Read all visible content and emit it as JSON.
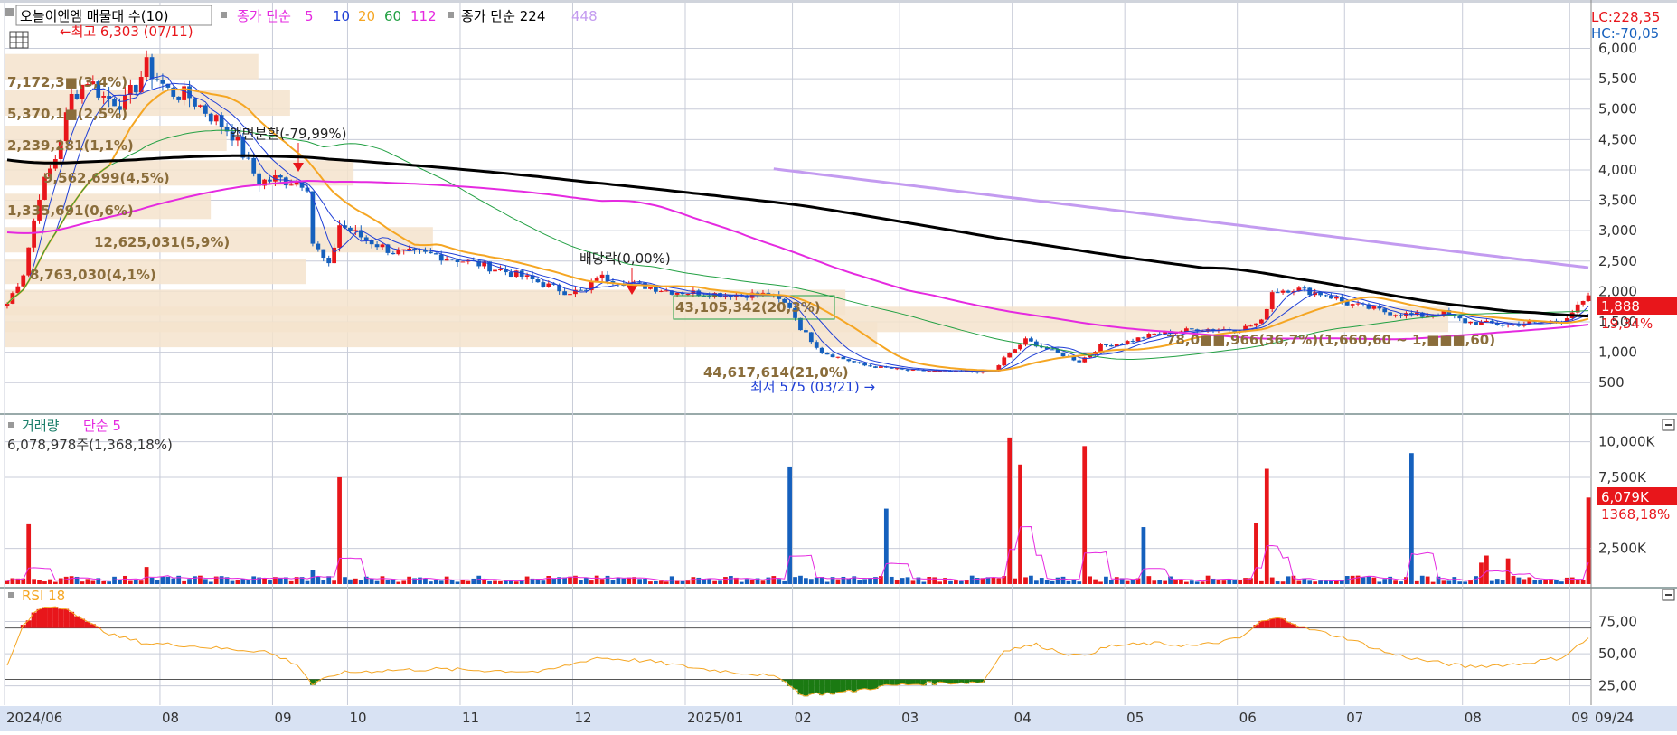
{
  "colors": {
    "up": "#e8161b",
    "down": "#1560bd",
    "ma5": "#1f3fd6",
    "ma10": "#1f3fd6",
    "ma20": "#f5a623",
    "ma60": "#22a043",
    "ma112": "#e52ae0",
    "ma224": "#000000",
    "ma448": "#c39bf0",
    "profile": "#f5e3cc",
    "rsi_line": "#f5a623",
    "rsi_hot": "#e8161b",
    "rsi_cold": "#1b7a12",
    "grid": "#c8ccd8",
    "axis_bg": "#d8e2f3"
  },
  "header": {
    "title": "오늘이엔엠 매물대 수(10)",
    "ma_label": "종가 단순",
    "ma_periods": [
      "5",
      "10",
      "20",
      "60",
      "112"
    ],
    "ma2_label": "종가 단순 224",
    "ma2_extra": "448",
    "lc_label": "LC:228,35",
    "hc_label": "HC:-70,05",
    "grid_icon": "grid-icon"
  },
  "annotations": {
    "high_label": "←최고 6,303 (07/11)",
    "low_label": "최저 575 (03/21) →",
    "split_label": "액면분할(-79,99%)",
    "dividend_label": "배당락(0,00%)"
  },
  "profile_labels": [
    "7,172,3■(3,4%)",
    "5,370,1■(2,5%)",
    "2,239,281(1,1%)",
    "9,562,699(4,5%)",
    "1,335,691(0,6%)",
    "12,625,031(5,9%)",
    "8,763,030(4,1%)",
    "43,105,342(20,3%)",
    "44,617,614(21,0%)",
    "78,0■■,966(36,7%)(1,660,60 ~ 1,■■■,60)"
  ],
  "volume_panel": {
    "title": "거래량",
    "ma_label": "단순 5",
    "current_label": "6,078,978주(1,368,18%)",
    "current_badge": "6,079K",
    "current_pct": "1368,18%"
  },
  "rsi_panel": {
    "title": "RSI 18"
  },
  "price_badge": {
    "value": "1,888",
    "pct": "19,34%"
  },
  "x_axis": {
    "labels": [
      "2024/06",
      "08",
      "09",
      "10",
      "11",
      "12",
      "2025/01",
      "02",
      "03",
      "04",
      "05",
      "06",
      "07",
      "08",
      "09"
    ],
    "last_label": "09/24"
  },
  "chart_data": {
    "type": "candlestick",
    "price_axis": {
      "ticks": [
        "6,000",
        "5,500",
        "5,000",
        "4,500",
        "4,000",
        "3,500",
        "3,000",
        "2,500",
        "2,000",
        "1,500",
        "1,000",
        "500"
      ],
      "range": [
        250,
        6350
      ]
    },
    "volume_axis": {
      "ticks": [
        "10,000K",
        "7,500K",
        "2,500K"
      ],
      "range": [
        0,
        11500
      ]
    },
    "rsi_axis": {
      "ticks": [
        "75,00",
        "50,00",
        "25,00"
      ],
      "range": [
        10,
        100
      ],
      "upper": 70,
      "lower": 30
    },
    "price_keyframes": [
      [
        0,
        1800
      ],
      [
        3,
        2300
      ],
      [
        6,
        3600
      ],
      [
        9,
        4200
      ],
      [
        12,
        5200
      ],
      [
        15,
        5500
      ],
      [
        18,
        5200
      ],
      [
        22,
        5100
      ],
      [
        26,
        5700
      ],
      [
        30,
        5300
      ],
      [
        34,
        5200
      ],
      [
        38,
        4900
      ],
      [
        42,
        4600
      ],
      [
        45,
        4100
      ],
      [
        47,
        3800
      ],
      [
        50,
        3850
      ],
      [
        55,
        3800
      ],
      [
        56,
        3750
      ],
      [
        57,
        2800
      ],
      [
        60,
        2400
      ],
      [
        62,
        3100
      ],
      [
        66,
        2900
      ],
      [
        72,
        2650
      ],
      [
        80,
        2600
      ],
      [
        88,
        2450
      ],
      [
        96,
        2250
      ],
      [
        104,
        2000
      ],
      [
        108,
        2000
      ],
      [
        110,
        2250
      ],
      [
        118,
        2100
      ],
      [
        124,
        2000
      ],
      [
        134,
        1950
      ],
      [
        142,
        1950
      ],
      [
        146,
        1750
      ],
      [
        148,
        1400
      ],
      [
        152,
        1000
      ],
      [
        160,
        780
      ],
      [
        168,
        700
      ],
      [
        176,
        680
      ],
      [
        184,
        680
      ],
      [
        186,
        900
      ],
      [
        190,
        1200
      ],
      [
        194,
        1050
      ],
      [
        198,
        920
      ],
      [
        200,
        850
      ],
      [
        204,
        1100
      ],
      [
        208,
        1150
      ],
      [
        214,
        1300
      ],
      [
        222,
        1380
      ],
      [
        230,
        1380
      ],
      [
        234,
        1500
      ],
      [
        236,
        2000
      ],
      [
        240,
        2050
      ],
      [
        246,
        1950
      ],
      [
        250,
        1800
      ],
      [
        258,
        1650
      ],
      [
        264,
        1600
      ],
      [
        268,
        1650
      ],
      [
        272,
        1500
      ],
      [
        280,
        1450
      ],
      [
        290,
        1520
      ],
      [
        295,
        1888
      ]
    ],
    "volume_spikes": [
      [
        4,
        4200
      ],
      [
        26,
        1200
      ],
      [
        57,
        1000
      ],
      [
        62,
        7500
      ],
      [
        146,
        8200
      ],
      [
        164,
        5300
      ],
      [
        187,
        10300
      ],
      [
        189,
        8400
      ],
      [
        201,
        9700
      ],
      [
        212,
        4000
      ],
      [
        233,
        4300
      ],
      [
        235,
        8100
      ],
      [
        275,
        1500
      ],
      [
        275.5,
        2000
      ],
      [
        262,
        9200
      ],
      [
        280,
        1800
      ],
      [
        295,
        6079
      ]
    ],
    "rsi_keyframes": [
      [
        0,
        40
      ],
      [
        3,
        72
      ],
      [
        6,
        85
      ],
      [
        9,
        87
      ],
      [
        12,
        84
      ],
      [
        15,
        74
      ],
      [
        20,
        64
      ],
      [
        26,
        58
      ],
      [
        32,
        57
      ],
      [
        40,
        54
      ],
      [
        48,
        52
      ],
      [
        54,
        42
      ],
      [
        57,
        26
      ],
      [
        62,
        35
      ],
      [
        70,
        37
      ],
      [
        80,
        38
      ],
      [
        90,
        37
      ],
      [
        100,
        36
      ],
      [
        110,
        47
      ],
      [
        120,
        44
      ],
      [
        130,
        38
      ],
      [
        140,
        34
      ],
      [
        145,
        30
      ],
      [
        148,
        18
      ],
      [
        156,
        20
      ],
      [
        164,
        25
      ],
      [
        172,
        27
      ],
      [
        182,
        28
      ],
      [
        186,
        53
      ],
      [
        192,
        57
      ],
      [
        196,
        52
      ],
      [
        200,
        48
      ],
      [
        206,
        56
      ],
      [
        214,
        58
      ],
      [
        222,
        56
      ],
      [
        230,
        62
      ],
      [
        234,
        75
      ],
      [
        238,
        78
      ],
      [
        242,
        70
      ],
      [
        250,
        62
      ],
      [
        258,
        50
      ],
      [
        264,
        45
      ],
      [
        272,
        40
      ],
      [
        282,
        42
      ],
      [
        290,
        47
      ],
      [
        295,
        62
      ]
    ]
  }
}
